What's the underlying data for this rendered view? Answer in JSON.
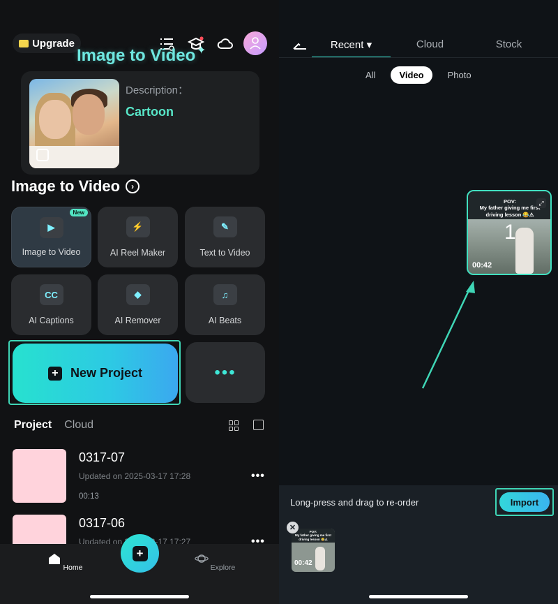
{
  "left": {
    "upgrade_label": "Upgrade",
    "promo": {
      "title": "Image to Video",
      "description_label": "Description：",
      "description_value": "Cartoon"
    },
    "section_title": "Image to Video",
    "tools": [
      {
        "label": "Image to Video",
        "badge": "New",
        "icon": "image-video-icon"
      },
      {
        "label": "AI Reel Maker",
        "icon": "reel-bolt-icon"
      },
      {
        "label": "Text  to Video",
        "icon": "text-video-icon"
      },
      {
        "label": "AI Captions",
        "icon_text": "CC",
        "icon": "captions-icon"
      },
      {
        "label": "AI Remover",
        "icon": "eraser-icon"
      },
      {
        "label": "AI Beats",
        "icon": "beats-icon"
      }
    ],
    "new_project_label": "New Project",
    "more_label": "•••",
    "tabs": {
      "project": "Project",
      "cloud": "Cloud"
    },
    "projects": [
      {
        "name": "0317-07",
        "updated": "Updated on 2025-03-17 17:28",
        "duration": "00:13"
      },
      {
        "name": "0317-06",
        "updated": "Updated on 2025-03-17 17:27",
        "duration": ""
      }
    ],
    "nav": {
      "home": "Home",
      "explore": "Explore"
    }
  },
  "right": {
    "tabs": {
      "recent": "Recent",
      "cloud": "Cloud",
      "stock": "Stock"
    },
    "filters": {
      "all": "All",
      "video": "Video",
      "photo": "Photo"
    },
    "media": {
      "caption": "POV: My father giving me first driving lesson 😂🚗",
      "caption_title": "POV:",
      "caption_body": "My father giving me first driving lesson 😂⚠",
      "selection_number": "1",
      "duration": "00:42"
    },
    "import_hint": "Long-press and drag to re-order",
    "import_label": "Import",
    "selected": {
      "caption_title": "POV:",
      "caption_body": "My father giving me first driving lesson 😂⚠",
      "duration": "00:42"
    }
  },
  "colors": {
    "accent": "#3fd6b6",
    "promo_title": "#6ee7e0",
    "thumb_pink": "#ffd3dc"
  }
}
